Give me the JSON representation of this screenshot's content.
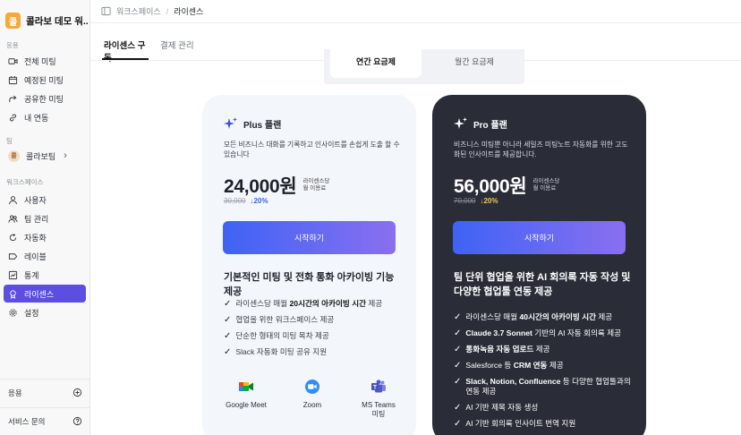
{
  "sidebar": {
    "workspace_logo": "콜",
    "workspace_name": "콜라보 데모 워...",
    "section_usage": "응용",
    "usage_items": [
      {
        "label": "전체 미팅",
        "icon": "video-icon"
      },
      {
        "label": "예정된 미팅",
        "icon": "calendar-icon"
      },
      {
        "label": "공유한 미팅",
        "icon": "share-icon"
      },
      {
        "label": "내 연동",
        "icon": "link-icon"
      }
    ],
    "section_team": "팀",
    "team": {
      "avatar": "콜",
      "label": "콜라보팀",
      "chevron": "›"
    },
    "section_workspace": "워크스페이스",
    "workspace_items": [
      {
        "label": "사용자",
        "icon": "user-icon"
      },
      {
        "label": "팀 관리",
        "icon": "team-icon"
      },
      {
        "label": "자동화",
        "icon": "automation-icon"
      },
      {
        "label": "레이블",
        "icon": "label-icon"
      },
      {
        "label": "통계",
        "icon": "stats-icon"
      },
      {
        "label": "라이센스",
        "icon": "license-icon",
        "active": true
      },
      {
        "label": "설정",
        "icon": "gear-icon"
      }
    ],
    "bottom_usage": "응용",
    "bottom_support": "서비스 문의"
  },
  "topbar": {
    "crumb_workspace": "워크스페이스",
    "separator": "/",
    "crumb_current": "라이센스"
  },
  "tabs": {
    "subscription": "라이센스 구독",
    "billing": "결제 관리"
  },
  "billing_toggle": {
    "annual": "연간 요금제",
    "monthly": "월간 요금제"
  },
  "plans": {
    "plus": {
      "name": "Plus 플랜",
      "description": "모든 비즈니스 대화를 기록하고 인사이트를 손쉽게 도출 할 수 있습니다",
      "price": "24,000원",
      "unit_line1": "라이센스당",
      "unit_line2": "월 이용료",
      "original_price": "30,000",
      "discount": "↓20%",
      "cta": "시작하기",
      "feature_title": "기본적인 미팅 및 전화 통화 아카이빙 기능 제공",
      "features": [
        {
          "pre": "라이센스당 매월 ",
          "bold": "20시간의 아카이빙 시간",
          "post": " 제공"
        },
        {
          "pre": "협업을 위한 워크스페이스 제공",
          "bold": "",
          "post": ""
        },
        {
          "pre": "단순한 형태의 미팅 목차 제공",
          "bold": "",
          "post": ""
        },
        {
          "pre": "Slack 자동화 미팅 공유 지원",
          "bold": "",
          "post": ""
        }
      ],
      "integrations": [
        {
          "label": "Google Meet",
          "icon": "google-meet-icon"
        },
        {
          "label": "Zoom",
          "icon": "zoom-icon"
        },
        {
          "label": "MS Teams\n미팅",
          "icon": "ms-teams-icon"
        }
      ]
    },
    "pro": {
      "name": "Pro 플랜",
      "description": "비즈니스 미팅뿐 아니라 세일즈 미팅노트 자동화를 위한 고도화된 인사이트를 제공합니다.",
      "price": "56,000원",
      "unit_line1": "라이센스당",
      "unit_line2": "월 이용료",
      "original_price": "70,000",
      "discount": "↓20%",
      "cta": "시작하기",
      "feature_title": "팀 단위 협업을 위한 AI 회의록 자동 작성 및 다양한 협업툴 연동 제공",
      "features": [
        {
          "pre": "라이센스당 매월 ",
          "bold": "40시간의 아카이빙 시간",
          "post": " 제공"
        },
        {
          "pre": "",
          "bold": "Claude 3.7 Sonnet",
          "post": " 기반의 AI 자동 회의록 제공"
        },
        {
          "pre": "",
          "bold": "통화녹음 자동 업로드",
          "post": " 제공"
        },
        {
          "pre": "Salesforce 등 ",
          "bold": "CRM 연동",
          "post": " 제공"
        },
        {
          "pre": "",
          "bold": "Slack, Notion, Confluence",
          "post": " 등 다양한 협업툴과의 연동 제공"
        },
        {
          "pre": "AI 기반 제목 자동 생성",
          "bold": "",
          "post": ""
        },
        {
          "pre": "AI 기반 회의록 인사이트 번역 지원",
          "bold": "",
          "post": ""
        }
      ]
    }
  },
  "colors": {
    "accent": "#5b4ee0",
    "cta_start": "#3e63f5",
    "cta_end": "#8a6ff0",
    "pro_bg": "#2a2d38",
    "plus_bg": "#f3f6fb"
  }
}
